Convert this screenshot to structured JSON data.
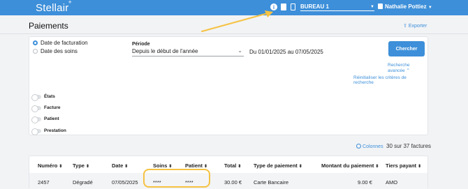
{
  "app": {
    "logo": "Stellair",
    "logo_mark": "+"
  },
  "topbar": {
    "office": "BUREAU 1",
    "user": "Nathalie Pottiez",
    "icons": [
      "info-icon",
      "document-icon",
      "card-icon"
    ]
  },
  "page": {
    "title": "Paiements",
    "export_label": "Exporter"
  },
  "filters": {
    "date_options": [
      {
        "label": "Date de facturation",
        "selected": true
      },
      {
        "label": "Date des soins",
        "selected": false
      }
    ],
    "period_label": "Période",
    "period_value": "Depuis le début de l'année",
    "date_range": "Du 01/01/2025 au 07/05/2025",
    "search_button": "Chercher",
    "advanced_search": "Recherche avancée",
    "reset": "Réinitialiser les critères de recherche",
    "toggles": [
      {
        "label": "États",
        "on": false
      },
      {
        "label": "Facture",
        "on": false
      },
      {
        "label": "Patient",
        "on": false
      },
      {
        "label": "Prestation",
        "on": false
      }
    ]
  },
  "results": {
    "columns_label": "Colonnes",
    "count": "30 sur 37 factures"
  },
  "table": {
    "headers": [
      "Numéro",
      "Type",
      "Date",
      "Soins",
      "Patient",
      "Total",
      "Type de paiement",
      "Montant du paiement",
      "Tiers payant"
    ],
    "rows": [
      [
        "2457",
        "Dégradé",
        "07/05/2025",
        "****",
        "****",
        "30.00 €",
        "Carte Bancaire",
        "9.00 €",
        "AMO"
      ]
    ]
  },
  "colors": {
    "accent": "#3d8fd9",
    "annotation": "#f5c242"
  }
}
